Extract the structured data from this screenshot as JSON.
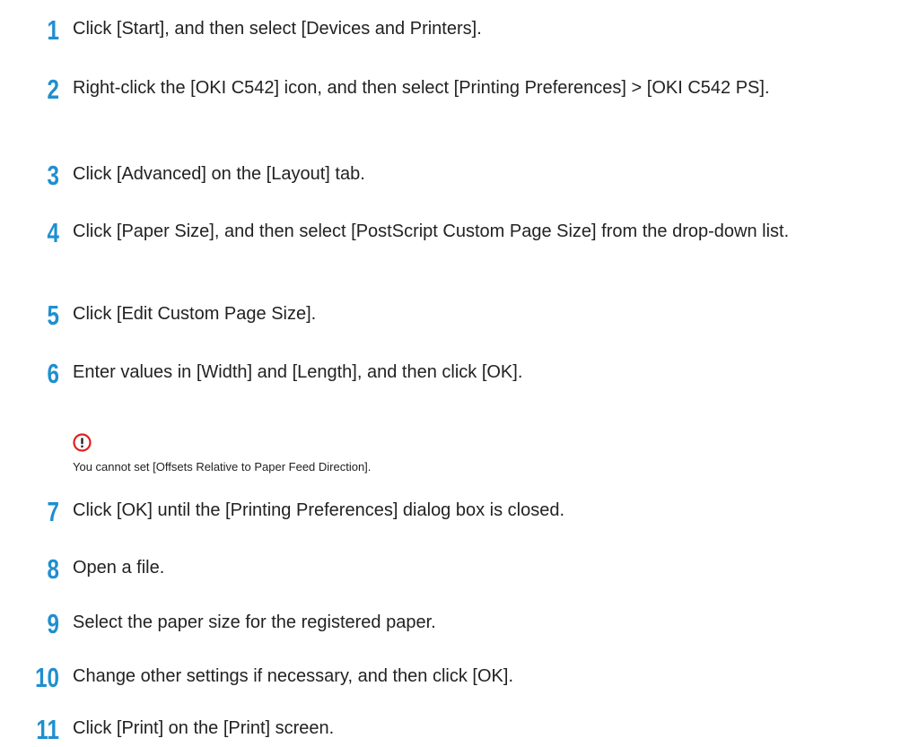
{
  "steps": [
    {
      "num": "1",
      "text": "Click [Start], and then select [Devices and Printers]."
    },
    {
      "num": "2",
      "text": "Right-click the [OKI C542] icon, and then select [Printing Preferences] > [OKI C542 PS]."
    },
    {
      "num": "3",
      "text": "Click [Advanced] on the [Layout] tab."
    },
    {
      "num": "4",
      "text": "Click [Paper Size], and then select [PostScript Custom Page Size] from the drop-down list."
    },
    {
      "num": "5",
      "text": "Click [Edit Custom Page Size]."
    },
    {
      "num": "6",
      "text": "Enter values in [Width] and [Length], and then click [OK]."
    },
    {
      "num": "7",
      "text": "Click [OK] until the [Printing Preferences] dialog box is closed."
    },
    {
      "num": "8",
      "text": "Open a file."
    },
    {
      "num": "9",
      "text": "Select the paper size for the registered paper."
    },
    {
      "num": "10",
      "text": "Change other settings if necessary, and then click [OK]."
    },
    {
      "num": "11",
      "text": "Click [Print] on the [Print] screen."
    }
  ],
  "note": {
    "icon": "caution-icon",
    "text": "You cannot set [Offsets Relative to Paper Feed Direction]."
  },
  "colors": {
    "step_number": "#1f8fd0",
    "caution_icon": "#e0201e",
    "text": "#222222"
  }
}
